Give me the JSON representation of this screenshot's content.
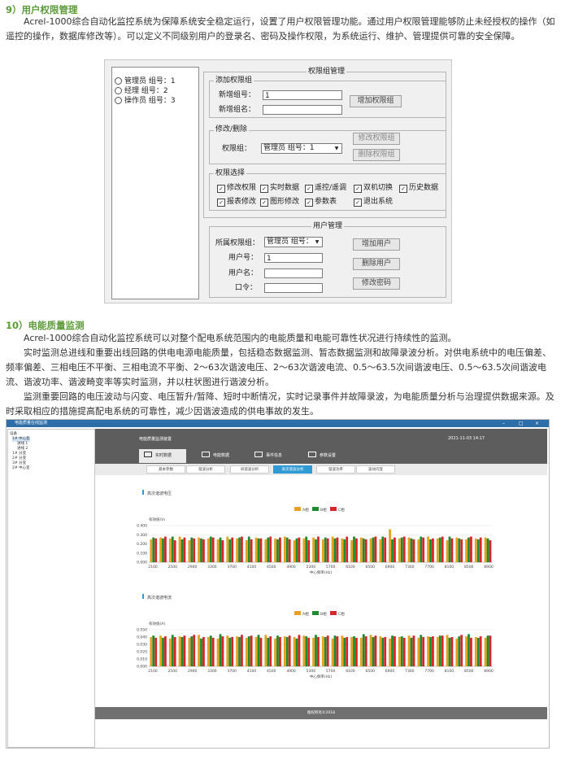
{
  "section9": {
    "heading": "9）用户权限管理",
    "para": "Acrel-1000综合自动化监控系统为保障系统安全稳定运行，设置了用户权限管理功能。通过用户权限管理能够防止未经授权的操作（如遥控的操作，数据库修改等）。可以定义不同级别用户的登录名、密码及操作权限，为系统运行、维护、管理提供可靠的安全保障。"
  },
  "dialog": {
    "tree": [
      "管理员 组号：1",
      "经理 组号：2",
      "操作员 组号：3"
    ],
    "group_title": "权限组管理",
    "add_group": {
      "legend": "添加权限组",
      "new_id_label": "新增组号：",
      "new_id_value": "1",
      "new_name_label": "新增组名：",
      "new_name_value": "",
      "add_button": "增加权限组"
    },
    "modify_group": {
      "legend": "修改/删除",
      "group_label": "权限组：",
      "group_value": "管理员 组号：1",
      "modify_button": "修改权限组",
      "delete_button": "删除权限组"
    },
    "perm_select": {
      "legend": "权限选择",
      "items": [
        {
          "label": "修改权限",
          "checked": true
        },
        {
          "label": "实时数据",
          "checked": true
        },
        {
          "label": "遥控/遥调",
          "checked": true
        },
        {
          "label": "双机切换",
          "checked": true
        },
        {
          "label": "历史数据",
          "checked": true
        },
        {
          "label": "报表修改",
          "checked": true
        },
        {
          "label": "图形修改",
          "checked": true
        },
        {
          "label": "参数表",
          "checked": true
        },
        {
          "label": "退出系统",
          "checked": true
        }
      ]
    },
    "user_mgmt": {
      "title": "用户管理",
      "group_label": "所属权限组：",
      "group_value": "管理员 组号：",
      "user_id_label": "用户号：",
      "user_id_value": "1",
      "user_name_label": "用户名：",
      "password_label": "口令：",
      "add_user": "增加用户",
      "delete_user": "删除用户",
      "change_pwd": "修改密码"
    }
  },
  "section10": {
    "heading": "10）电能质量监测",
    "para1": "Acrel-1000综合自动化监控系统可以对整个配电系统范围内的电能质量和电能可靠性状况进行持续性的监测。",
    "para2": "实时监测总进线和重要出线回路的供电电源电能质量，包括稳态数据监测、暂态数据监测和故障录波分析。对供电系统中的电压偏差、频率偏差、三相电压不平衡、三相电流不平衡、2～63次谐波电压、2～63次谐波电流、0.5～63.5次间谐波电压、0.5～63.5次间谐波电流、谐波功率、谐波畸变率等实时监测，并以柱状图进行谐波分析。",
    "para3": "监测重要回路的电压波动与闪变、电压暂升/暂降、短时中断情况，实时记录事件并故障录波，为电能质量分析与治理提供数据来源。及时采取相应的措施提高配电系统的可靠性，减少因谐波造成的供电事故的发生。"
  },
  "app": {
    "window_title": "电能质量在线监测",
    "window_controls": [
      "–",
      "□",
      "×"
    ],
    "header_title": "电能质量监测装置",
    "header_time": "2021-11-03 14:17",
    "tree": [
      {
        "label": "设备",
        "indent": 0
      },
      {
        "label": "1# 中心变",
        "indent": 1,
        "selected": true
      },
      {
        "label": "进线 1",
        "indent": 3
      },
      {
        "label": "进线 2",
        "indent": 3
      },
      {
        "label": "1# 分变",
        "indent": 1
      },
      {
        "label": "2# 分变",
        "indent": 1
      },
      {
        "label": "3# 分变",
        "indent": 1
      },
      {
        "label": "2# 中心变",
        "indent": 1
      }
    ],
    "nav_tabs": [
      "实时数据",
      "电能数据",
      "事件信息",
      "参数设置"
    ],
    "sub_tabs": [
      "基本参数",
      "谐波分析",
      "间谐波分析",
      "高次谐波分析",
      "谐波功率",
      "波动闪变"
    ],
    "active_sub_tab": "高次谐波分析",
    "footer": "版权所有©2018"
  },
  "colors": {
    "phaseA": "#e6a21e",
    "phaseB": "#1f8a2e",
    "phaseC": "#d9252a",
    "accent": "#2f9ad3",
    "heading": "#5b9b3a"
  },
  "chart_data": [
    {
      "type": "bar",
      "title": "高次谐波电压",
      "ylabel": "有效值(V)",
      "xlabel": "中心频率(Hz)",
      "ylim": [
        0,
        0.4
      ],
      "yticks": [
        "0.400",
        "0.300",
        "0.200",
        "0.100",
        "0.000"
      ],
      "xticks": [
        "2100",
        "2500",
        "2900",
        "3300",
        "3700",
        "4100",
        "4500",
        "4900",
        "5300",
        "5700",
        "6100",
        "6500",
        "6900",
        "7300",
        "7700",
        "8100",
        "8500",
        "8900"
      ],
      "legend": [
        "A相",
        "B相",
        "C相"
      ],
      "series": [
        {
          "name": "A相",
          "values": [
            0.25,
            0.27,
            0.26,
            0.28,
            0.24,
            0.27,
            0.26,
            0.25,
            0.28,
            0.26,
            0.24,
            0.27,
            0.25,
            0.26,
            0.28,
            0.24,
            0.26,
            0.27,
            0.25,
            0.28,
            0.26,
            0.24,
            0.27,
            0.26,
            0.25,
            0.36,
            0.26,
            0.27,
            0.25,
            0.28,
            0.26,
            0.24,
            0.27,
            0.25,
            0.26,
            0.27
          ]
        },
        {
          "name": "B相",
          "values": [
            0.27,
            0.26,
            0.28,
            0.25,
            0.27,
            0.26,
            0.28,
            0.27,
            0.25,
            0.27,
            0.28,
            0.26,
            0.27,
            0.25,
            0.27,
            0.26,
            0.28,
            0.25,
            0.27,
            0.26,
            0.25,
            0.28,
            0.26,
            0.27,
            0.28,
            0.25,
            0.27,
            0.26,
            0.28,
            0.25,
            0.27,
            0.28,
            0.26,
            0.27,
            0.25,
            0.26
          ]
        },
        {
          "name": "C相",
          "values": [
            0.26,
            0.28,
            0.24,
            0.27,
            0.26,
            0.25,
            0.27,
            0.24,
            0.27,
            0.28,
            0.25,
            0.26,
            0.28,
            0.27,
            0.25,
            0.27,
            0.24,
            0.28,
            0.26,
            0.27,
            0.28,
            0.26,
            0.25,
            0.28,
            0.27,
            0.27,
            0.28,
            0.25,
            0.27,
            0.26,
            0.28,
            0.26,
            0.25,
            0.28,
            0.27,
            0.24
          ]
        }
      ]
    },
    {
      "type": "bar",
      "title": "高次谐波电流",
      "ylabel": "有效值(A)",
      "xlabel": "中心频率(Hz)",
      "ylim": [
        0,
        0.05
      ],
      "yticks": [
        "0.050",
        "0.040",
        "0.030",
        "0.020",
        "0.010",
        "0.000"
      ],
      "xticks": [
        "2100",
        "2500",
        "2900",
        "3300",
        "3700",
        "4100",
        "4500",
        "4900",
        "5300",
        "5700",
        "6100",
        "6500",
        "6900",
        "7300",
        "7700",
        "8100",
        "8500",
        "8900"
      ],
      "legend": [
        "A相",
        "B相",
        "C相"
      ],
      "series": [
        {
          "name": "A相",
          "values": [
            0.04,
            0.042,
            0.038,
            0.041,
            0.039,
            0.043,
            0.04,
            0.038,
            0.042,
            0.041,
            0.039,
            0.04,
            0.043,
            0.038,
            0.041,
            0.04,
            0.042,
            0.039,
            0.041,
            0.038,
            0.042,
            0.04,
            0.039,
            0.043,
            0.041,
            0.038,
            0.04,
            0.042,
            0.039,
            0.041,
            0.04,
            0.043,
            0.038,
            0.041,
            0.04,
            0.039
          ]
        },
        {
          "name": "B相",
          "values": [
            0.042,
            0.039,
            0.043,
            0.04,
            0.041,
            0.038,
            0.042,
            0.044,
            0.039,
            0.04,
            0.041,
            0.043,
            0.039,
            0.042,
            0.04,
            0.038,
            0.041,
            0.043,
            0.04,
            0.042,
            0.039,
            0.041,
            0.044,
            0.04,
            0.039,
            0.042,
            0.041,
            0.039,
            0.043,
            0.04,
            0.042,
            0.039,
            0.041,
            0.044,
            0.039,
            0.042
          ]
        },
        {
          "name": "C相",
          "values": [
            0.039,
            0.041,
            0.04,
            0.042,
            0.043,
            0.04,
            0.039,
            0.041,
            0.04,
            0.043,
            0.042,
            0.039,
            0.041,
            0.04,
            0.042,
            0.043,
            0.039,
            0.04,
            0.042,
            0.041,
            0.04,
            0.039,
            0.041,
            0.042,
            0.04,
            0.041,
            0.039,
            0.042,
            0.04,
            0.041,
            0.042,
            0.04,
            0.043,
            0.039,
            0.041,
            0.042
          ]
        }
      ]
    }
  ]
}
